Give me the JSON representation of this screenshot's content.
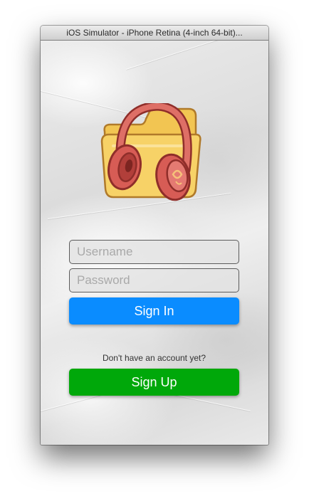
{
  "window": {
    "title": "iOS Simulator - iPhone Retina (4-inch 64-bit)..."
  },
  "logo": {
    "icon": "folder-with-headphones-icon",
    "colors": {
      "folder": "#f7d267",
      "headphones": "#d9605a"
    }
  },
  "login": {
    "username_placeholder": "Username",
    "password_placeholder": "Password",
    "signin_label": "Sign In",
    "signup_prompt": "Don't have an account yet?",
    "signup_label": "Sign Up"
  },
  "colors": {
    "signin_button": "#0a8cff",
    "signup_button": "#00a80a"
  }
}
